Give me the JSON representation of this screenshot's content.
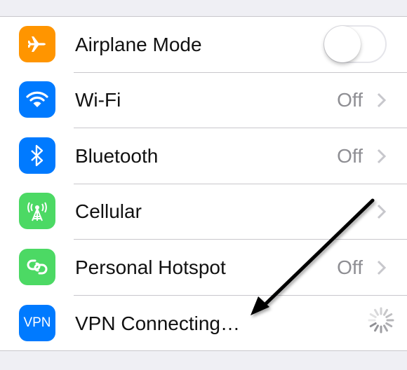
{
  "settings": {
    "rows": [
      {
        "label": "Airplane Mode",
        "icon": "airplane-icon",
        "icon_color": "#ff9500",
        "control": "toggle",
        "toggle_on": false
      },
      {
        "label": "Wi-Fi",
        "icon": "wifi-icon",
        "icon_color": "#007aff",
        "value": "Off",
        "control": "chevron"
      },
      {
        "label": "Bluetooth",
        "icon": "bluetooth-icon",
        "icon_color": "#007aff",
        "value": "Off",
        "control": "chevron"
      },
      {
        "label": "Cellular",
        "icon": "cellular-antenna-icon",
        "icon_color": "#4cd964",
        "value": "",
        "control": "chevron"
      },
      {
        "label": "Personal Hotspot",
        "icon": "hotspot-link-icon",
        "icon_color": "#4cd964",
        "value": "Off",
        "control": "chevron"
      },
      {
        "label": "VPN Connecting…",
        "icon": "vpn-icon",
        "icon_text": "VPN",
        "icon_color": "#007aff",
        "control": "spinner"
      }
    ]
  },
  "annotation": {
    "type": "arrow",
    "color": "#000000",
    "points_to": "VPN Connecting…"
  }
}
